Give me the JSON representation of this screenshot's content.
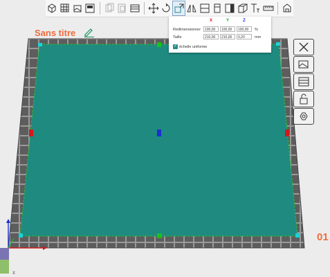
{
  "project": {
    "title": "Sans titre"
  },
  "scale_panel": {
    "axis_x": "X",
    "axis_y": "Y",
    "axis_z": "Z",
    "resize_label": "Redimensionner",
    "size_label": "Taille",
    "resize_x": "100,00",
    "resize_y": "100,00",
    "resize_z": "100,00",
    "resize_unit": "%",
    "size_x": "210,00",
    "size_y": "210,00",
    "size_z": "0,20",
    "size_unit": "mm",
    "uniform_label": "échelle uniforme",
    "uniform_checked": true
  },
  "viewport": {
    "layer_indicator": "01",
    "plate_color": "#1f8a80",
    "border_color": "#5a5a5a",
    "handle_corner_color": "#19d3d8",
    "handle_mid_green": "#18c21e",
    "handle_mid_red": "#d11a1a",
    "handle_center_blue": "#1a2fd1",
    "axis_x_label": "X"
  },
  "toolbar": {
    "icons": [
      "add-object-icon",
      "grid-icon",
      "import-image-icon",
      "layout-icon",
      "copy-icon",
      "paste-icon",
      "layers-icon",
      "move-icon",
      "rotate-icon",
      "scale-icon",
      "mirror-icon",
      "split-icon",
      "align-icon",
      "cut-icon",
      "3d-box-icon",
      "text-icon",
      "ruler-icon",
      "shape-icon"
    ]
  },
  "side_tools": {
    "icons": [
      "close-icon",
      "image-icon",
      "panel-icon",
      "lock-icon",
      "shape-tool-icon"
    ]
  },
  "accent_color": "#ef6b3d"
}
